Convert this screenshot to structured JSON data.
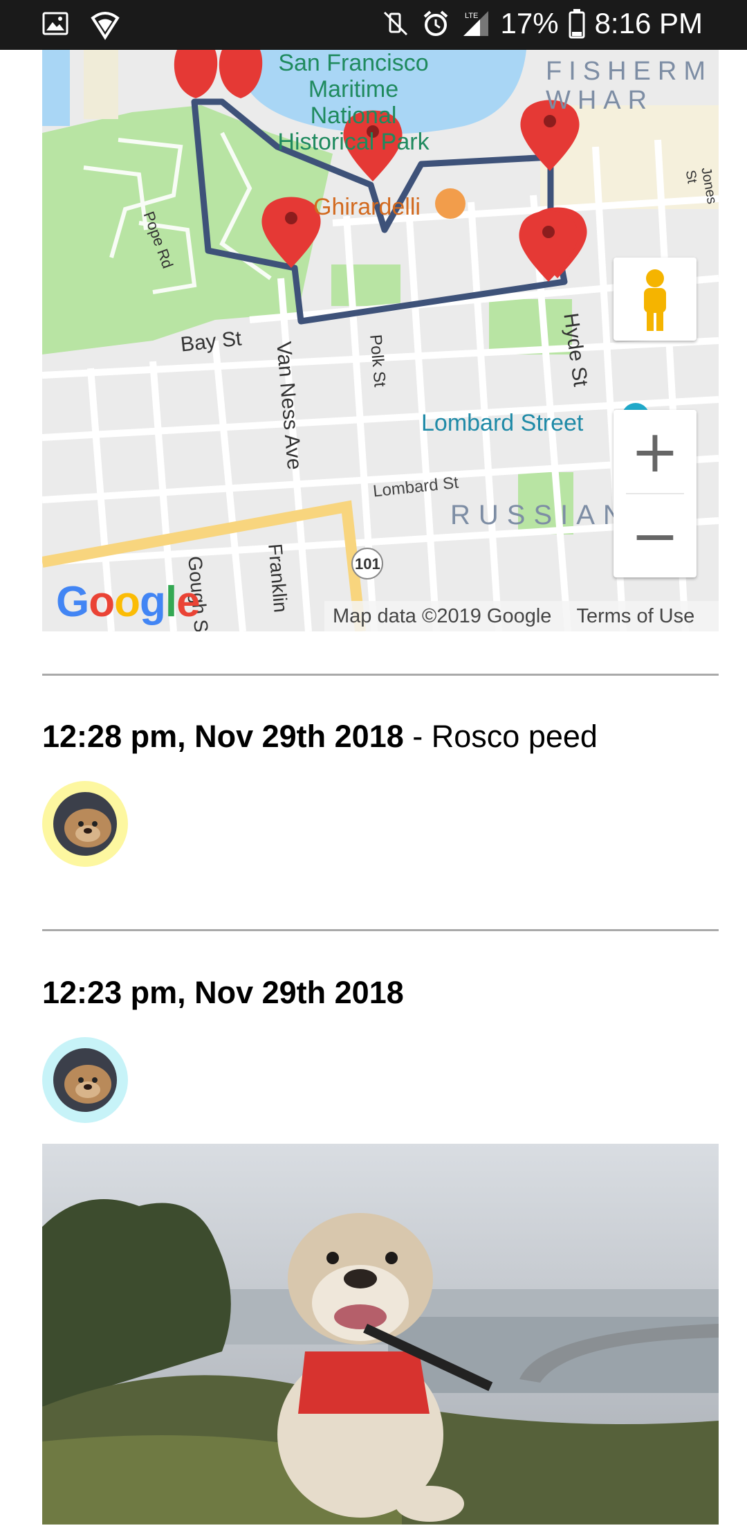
{
  "status_bar": {
    "battery": "17%",
    "time": "8:16 PM",
    "network": "LTE",
    "icons": [
      "gallery-icon",
      "wifi-shield-icon",
      "mute-icon",
      "alarm-icon",
      "signal-icon",
      "battery-icon"
    ]
  },
  "map": {
    "labels": {
      "maritime": "San Francisco\nMaritime\nNational\nHistorical Park",
      "fisherman": "FISHERM\nWHAR",
      "ghirardelli": "Ghirardelli",
      "pope_rd": "Pope Rd",
      "bay_st": "Bay St",
      "van_ness": "Van Ness Ave",
      "polk": "Polk St",
      "hyde": "Hyde St",
      "lombard_street": "Lombard Street",
      "lombard_st": "Lombard St",
      "russian": "RUSSIAN",
      "gough": "Gough S",
      "franklin": "Franklin",
      "hwy": "101",
      "jones": "Jones St"
    },
    "logo": "Google",
    "attribution": "Map data ©2019 Google",
    "terms": "Terms of Use",
    "zoom_in": "+",
    "zoom_out": "−"
  },
  "entries": [
    {
      "time": "12:28 pm, Nov 29th 2018",
      "separator": " - ",
      "note": "Rosco peed",
      "avatar_ring": "#fdf7a0"
    },
    {
      "time": "12:23 pm, Nov 29th 2018",
      "note": "",
      "avatar_ring": "#c7f3f8"
    }
  ],
  "colors": {
    "route": "#3e5279",
    "marker": "#e53935",
    "park": "#b8e4a3",
    "water": "#a9d6f5",
    "highway": "#f8d57e"
  }
}
